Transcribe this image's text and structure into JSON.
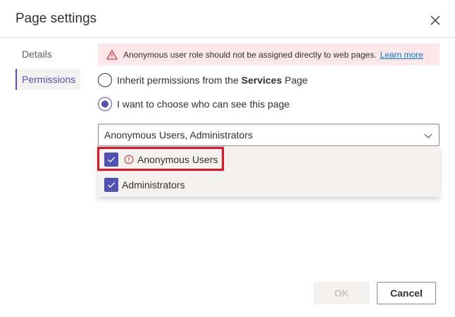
{
  "dialog": {
    "title": "Page settings",
    "close_icon": "close-icon"
  },
  "nav": {
    "items": [
      {
        "label": "Details",
        "active": false
      },
      {
        "label": "Permissions",
        "active": true
      }
    ]
  },
  "warning": {
    "icon": "warning-triangle-icon",
    "text": "Anonymous user role should not be assigned directly to web pages.",
    "link": "Learn more",
    "color": "#fde7e9"
  },
  "permissions": {
    "inherit": {
      "prefix": "Inherit permissions from the",
      "page_name": "Services",
      "suffix": "Page",
      "checked": false
    },
    "choose": {
      "label": "I want to choose who can see this page",
      "checked": true
    }
  },
  "roles_dropdown": {
    "value": "Anonymous Users, Administrators",
    "options": [
      {
        "label": "Anonymous Users",
        "checked": true,
        "error": true
      },
      {
        "label": "Administrators",
        "checked": true,
        "error": false
      }
    ]
  },
  "footer": {
    "ok_label": "OK",
    "cancel_label": "Cancel"
  },
  "colors": {
    "accent": "#4f52b2",
    "highlight": "#e81123",
    "error": "#d13438"
  }
}
